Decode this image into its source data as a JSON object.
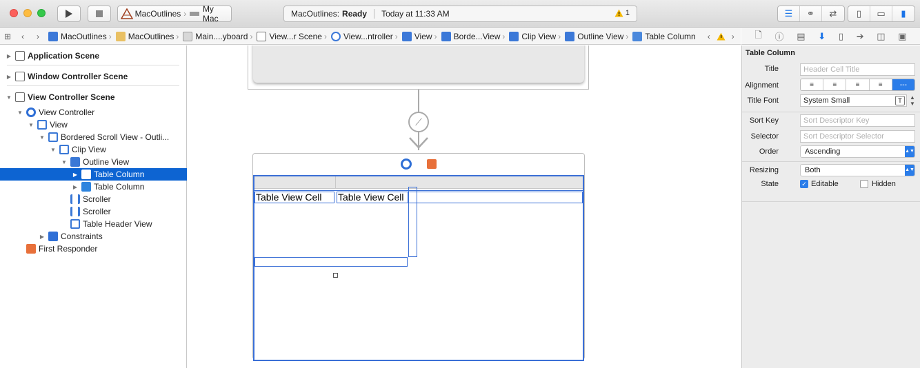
{
  "toolbar": {
    "scheme_target": "MacOutlines",
    "scheme_device": "My Mac",
    "status_project": "MacOutlines:",
    "status_state": "Ready",
    "status_time": "Today at 11:33 AM",
    "warning_count": "1"
  },
  "jumpbar": {
    "crumbs": [
      "MacOutlines",
      "MacOutlines",
      "Main....yboard",
      "View...r Scene",
      "View...ntroller",
      "View",
      "Borde...View",
      "Clip View",
      "Outline View",
      "Table Column"
    ]
  },
  "navigator": {
    "items": [
      {
        "label": "Application Scene"
      },
      {
        "label": "Window Controller Scene"
      },
      {
        "label": "View Controller Scene"
      },
      {
        "label": "View Controller"
      },
      {
        "label": "View"
      },
      {
        "label": "Bordered Scroll View - Outli..."
      },
      {
        "label": "Clip View"
      },
      {
        "label": "Outline View"
      },
      {
        "label": "Table Column"
      },
      {
        "label": "Table Column"
      },
      {
        "label": "Scroller"
      },
      {
        "label": "Scroller"
      },
      {
        "label": "Table Header View"
      },
      {
        "label": "Constraints"
      },
      {
        "label": "First Responder"
      }
    ]
  },
  "canvas": {
    "cell_1": "Table View Cell",
    "cell_2": "Table View Cell"
  },
  "inspector": {
    "section_title": "Table Column",
    "title_label": "Title",
    "title_placeholder": "Header Cell Title",
    "alignment_label": "Alignment",
    "title_font_label": "Title Font",
    "title_font_value": "System Small",
    "sort_key_label": "Sort Key",
    "sort_key_placeholder": "Sort Descriptor Key",
    "selector_label": "Selector",
    "selector_placeholder": "Sort Descriptor Selector",
    "order_label": "Order",
    "order_value": "Ascending",
    "resizing_label": "Resizing",
    "resizing_value": "Both",
    "state_label": "State",
    "editable_label": "Editable",
    "editable_checked": true,
    "hidden_label": "Hidden",
    "hidden_checked": false
  },
  "colors": {
    "selection": "#0d64d2",
    "accent": "#2b7de9",
    "canvas_outline": "#3a6fd6"
  }
}
